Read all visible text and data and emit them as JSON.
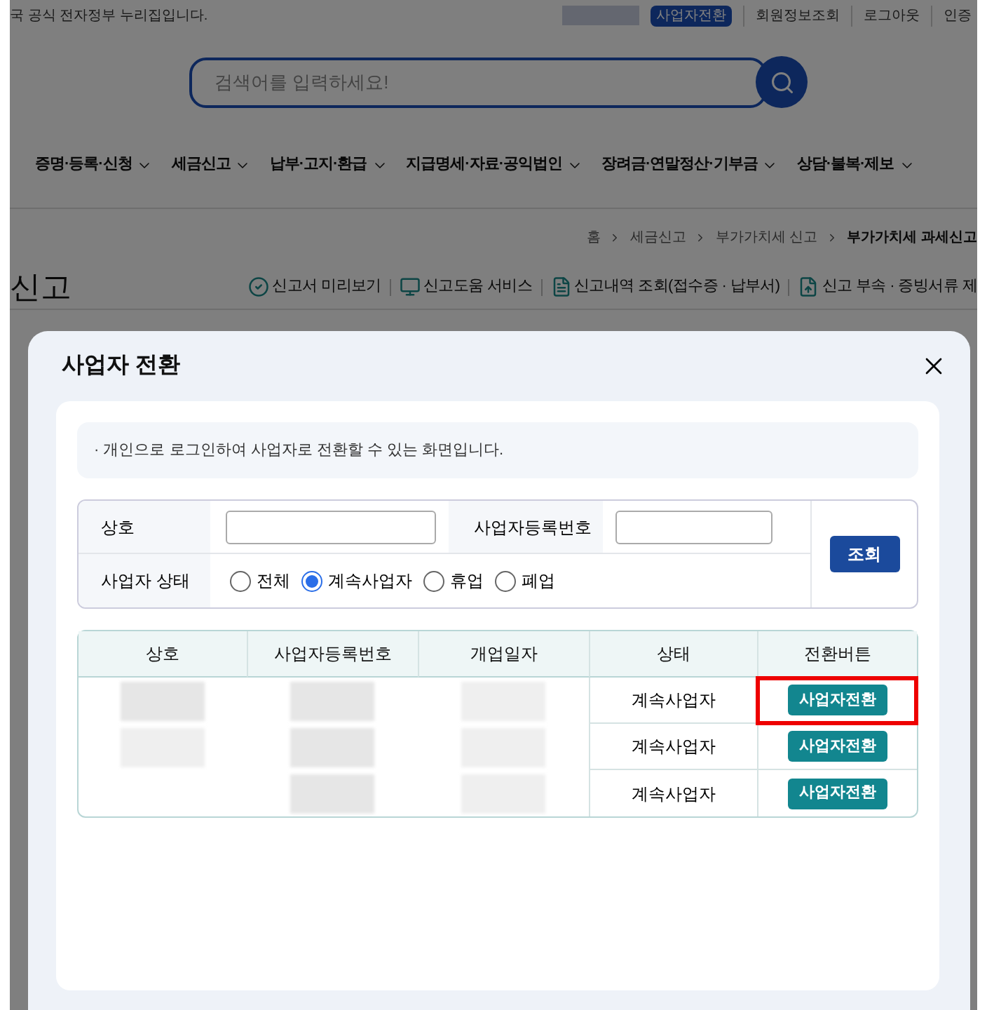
{
  "top_bar": {
    "notice": "국 공식 전자정부 누리집입니다.",
    "links": [
      {
        "label": "사업자전환",
        "kind": "badge"
      },
      {
        "label": "회원정보조회",
        "kind": "link"
      },
      {
        "label": "로그아웃",
        "kind": "link"
      },
      {
        "label": "인증",
        "kind": "link"
      }
    ]
  },
  "search": {
    "placeholder": "검색어를 입력하세요!"
  },
  "nav": [
    "증명·등록·신청",
    "세금신고",
    "납부·고지·환급",
    "지급명세·자료·공익법인",
    "장려금·연말정산·기부금",
    "상담·불복·제보"
  ],
  "breadcrumb": [
    {
      "label": "홈",
      "current": false
    },
    {
      "label": "세금신고",
      "current": false
    },
    {
      "label": "부가가치세 신고",
      "current": false
    },
    {
      "label": "부가가치세 과세신고",
      "current": true
    }
  ],
  "page_title": "신고",
  "toolbar": [
    {
      "label": "신고서 미리보기",
      "kind": "check"
    },
    {
      "label": "신고도움 서비스",
      "kind": "monitor"
    },
    {
      "label": "신고내역 조회(접수증 · 납부서)",
      "kind": "document"
    },
    {
      "label": "신고 부속 · 증빙서류 제",
      "kind": "upload"
    }
  ],
  "modal": {
    "title": "사업자 전환",
    "notice": "· 개인으로 로그인하여 사업자로 전환할 수 있는 화면입니다.",
    "form": {
      "name_label": "상호",
      "regno_label": "사업자등록번호",
      "status_label": "사업자 상태",
      "search_button": "조회",
      "statuses": [
        {
          "label": "전체",
          "selected": false
        },
        {
          "label": "계속사업자",
          "selected": true
        },
        {
          "label": "휴업",
          "selected": false
        },
        {
          "label": "폐업",
          "selected": false
        }
      ]
    },
    "table": {
      "columns": [
        "상호",
        "사업자등록번호",
        "개업일자",
        "상태",
        "전환버튼"
      ],
      "rows": [
        {
          "status": "계속사업자",
          "button": "사업자전환",
          "highlighted": true
        },
        {
          "status": "계속사업자",
          "button": "사업자전환",
          "highlighted": false
        },
        {
          "status": "계속사업자",
          "button": "사업자전환",
          "highlighted": false
        }
      ]
    }
  }
}
